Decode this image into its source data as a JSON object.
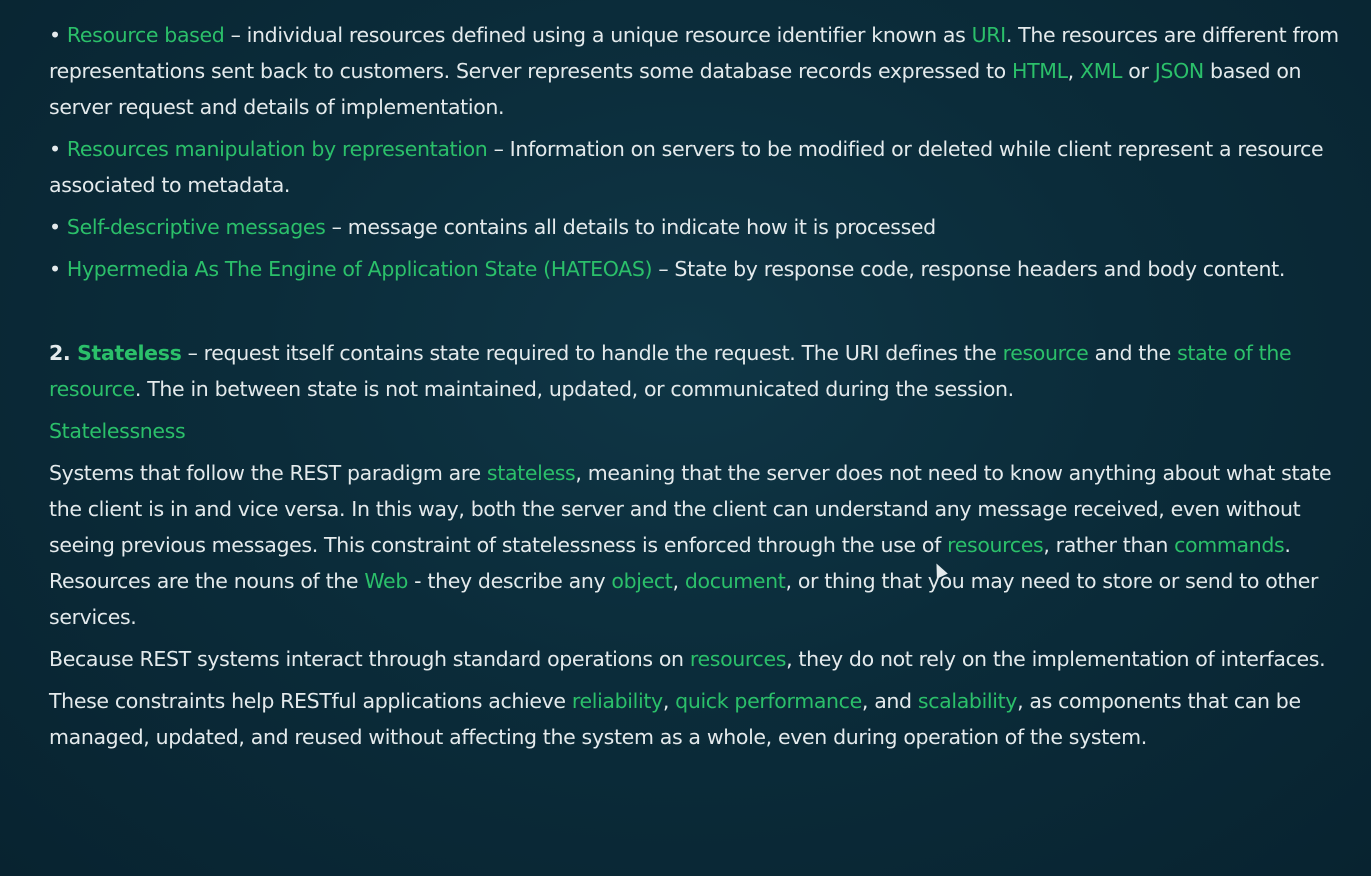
{
  "bullet": "•",
  "sep": " – ",
  "comma": ", ",
  "p1": {
    "term": "Resource based",
    "t1": "individual resources defined using a unique resource identifier known as ",
    "uri": "URI",
    "t2": ". The resources are different from representations sent back to customers. Server represents some database records expressed to ",
    "html": "HTML",
    "xml": "XML",
    "or": " or ",
    "json": "JSON",
    "t3": " based on server request and details of implementation."
  },
  "p2": {
    "term": "Resources manipulation by representation",
    "t1": "Information on servers to be modified or deleted while client represent a resource associated to metadata."
  },
  "p3": {
    "term": "Self-descriptive messages",
    "t1": "message contains all details to indicate how it is processed"
  },
  "p4": {
    "term": "Hypermedia As The Engine of Application State (HATEOAS)",
    "t1": "State by response code, response headers and body content."
  },
  "p5": {
    "num": "2. ",
    "term": "Stateless",
    "t1": "request itself contains state required to handle the request. The URI defines the ",
    "resource": "resource",
    "and": " and the ",
    "state": "state of the resource",
    "t2": ". The in between state is not maintained, updated, or communicated during the session."
  },
  "heading": "Statelessness",
  "p6": {
    "t1": "Systems that follow the REST paradigm are ",
    "stateless": "stateless",
    "t2": ", meaning that the server does not need to know anything about what state the client is in and vice versa. In this way, both the server and the client can understand any message received, even without seeing previous messages. This constraint of statelessness is enforced through the use of ",
    "resources": "resources",
    "t3": ", rather than ",
    "commands": "commands",
    "t4": ". Resources are the nouns of the ",
    "web": "Web",
    "t5": " - they describe any ",
    "object": "object",
    "document": "document",
    "t6": ", or thing that you may need to store or send to other services."
  },
  "p7": {
    "t1": "Because REST systems interact through standard operations on ",
    "resources": "resources",
    "t2": ", they do not rely on the implementation of interfaces."
  },
  "p8": {
    "t1": "These constraints help RESTful applications achieve ",
    "reliability": "reliability",
    "quick": "quick performance",
    "and": ", and ",
    "scalability": "scalability",
    "t2": ", as components that can be managed, updated, and reused without affecting the system as a whole, even during operation of the system."
  },
  "colors": {
    "background": "#0b2c3a",
    "text": "#e4eaec",
    "highlight": "#2bc06a"
  }
}
